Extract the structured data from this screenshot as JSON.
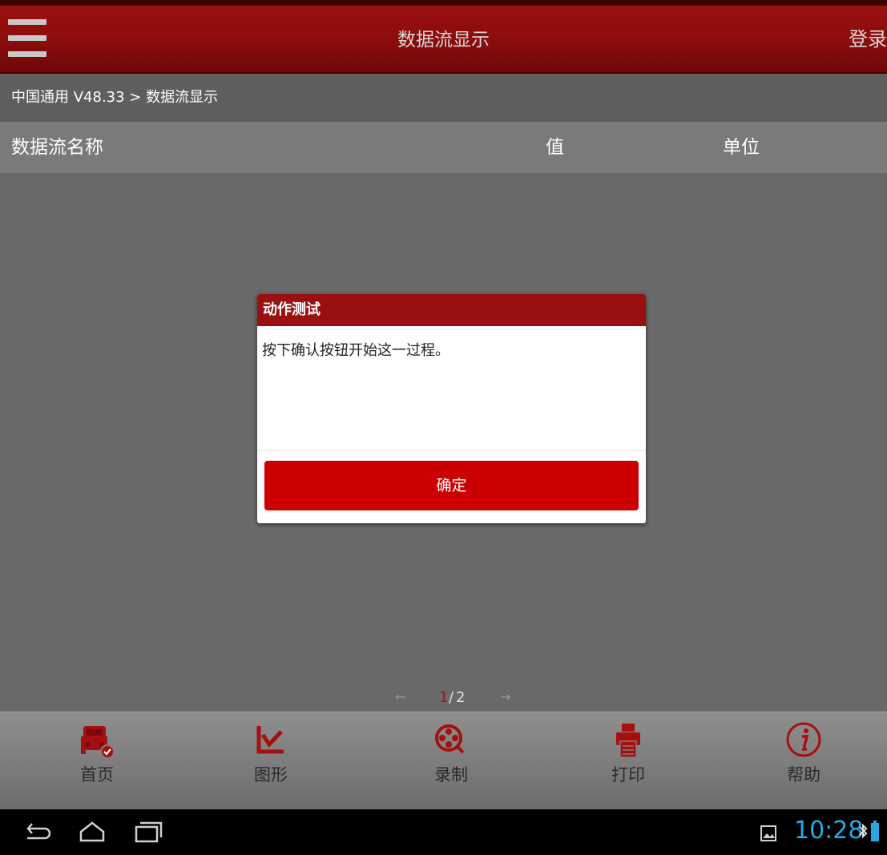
{
  "topbar": {
    "title": "数据流显示",
    "login_label": "登录"
  },
  "breadcrumb": "中国通用 V48.33 > 数据流显示",
  "table": {
    "columns": [
      "数据流名称",
      "值",
      "单位"
    ]
  },
  "dialog": {
    "title": "动作测试",
    "message": "按下确认按钮开始这一过程。",
    "ok_label": "确定"
  },
  "pager": {
    "current": "1",
    "separator": "/",
    "total": "2",
    "prev_icon": "arrow-left-icon",
    "next_icon": "arrow-right-icon"
  },
  "toolbar": [
    {
      "label": "首页",
      "icon": "car-home-icon"
    },
    {
      "label": "图形",
      "icon": "graph-icon"
    },
    {
      "label": "录制",
      "icon": "film-reel-icon"
    },
    {
      "label": "打印",
      "icon": "printer-icon"
    },
    {
      "label": "帮助",
      "icon": "info-icon"
    }
  ],
  "system_bar": {
    "time": "10:28",
    "icons": [
      "back-icon",
      "home-icon",
      "recents-icon",
      "gallery-icon",
      "bluetooth-icon",
      "battery-icon"
    ]
  },
  "colors": {
    "accent": "#cc0000",
    "header": "#9a1010",
    "clock": "#2aa6e3",
    "background": "#696969"
  }
}
